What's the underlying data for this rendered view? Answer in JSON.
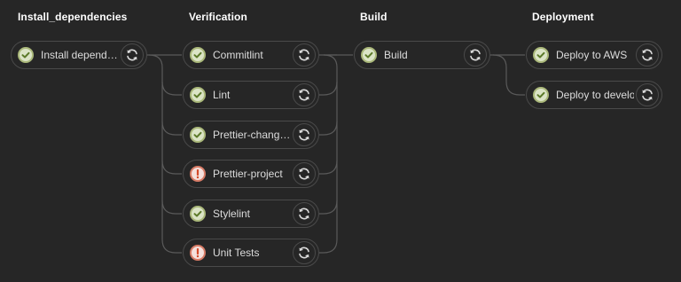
{
  "stages": [
    {
      "title": "Install_dependencies",
      "jobs": [
        {
          "name": "Install depende…",
          "status": "success"
        }
      ]
    },
    {
      "title": "Verification",
      "jobs": [
        {
          "name": "Commitlint",
          "status": "success"
        },
        {
          "name": "Lint",
          "status": "success"
        },
        {
          "name": "Prettier-change…",
          "status": "success"
        },
        {
          "name": "Prettier-project",
          "status": "failed"
        },
        {
          "name": "Stylelint",
          "status": "success"
        },
        {
          "name": "Unit Tests",
          "status": "failed"
        }
      ]
    },
    {
      "title": "Build",
      "jobs": [
        {
          "name": "Build",
          "status": "success"
        }
      ]
    },
    {
      "title": "Deployment",
      "jobs": [
        {
          "name": "Deploy to AWS",
          "status": "success"
        },
        {
          "name": "Deploy to develop",
          "status": "success"
        }
      ]
    }
  ],
  "icons": {
    "success": "check-icon",
    "failed": "exclamation-icon",
    "retry": "retry-icon"
  },
  "colors": {
    "background": "#262626",
    "success_fill": "#dbe4c6",
    "success_border": "#aab87a",
    "success_mark": "#5c7a2a",
    "failed_fill": "#f5e0dc",
    "failed_border": "#d77b66",
    "failed_mark": "#d44a2a",
    "connector": "#5a5a5a"
  }
}
